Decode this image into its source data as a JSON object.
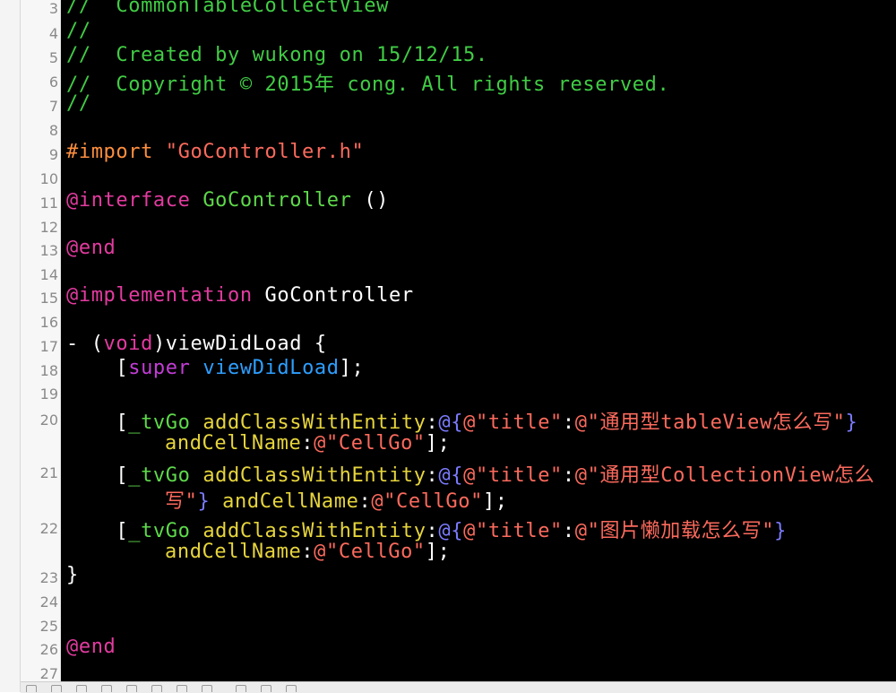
{
  "colors": {
    "background": "#000000",
    "comment": "#41cc45",
    "preprocessor": "#fd8f3f",
    "string": "#fc6a5d",
    "keyword": "#e33ba0",
    "class_name": "#5ed94b",
    "method": "#e6d43c",
    "plain": "#ffffff",
    "self_super": "#c33dd6",
    "system_method": "#2e9fff",
    "literal_brace": "#7b7bff",
    "line_number": "#8a8a8a"
  },
  "editor": {
    "lines": [
      {
        "n": "3",
        "segments": [
          {
            "t": "//  CommonTableCollectView",
            "c": "comment"
          }
        ]
      },
      {
        "n": "4",
        "segments": [
          {
            "t": "//",
            "c": "comment"
          }
        ]
      },
      {
        "n": "5",
        "segments": [
          {
            "t": "//  Created by wukong on 15/12/15.",
            "c": "comment"
          }
        ]
      },
      {
        "n": "6",
        "segments": [
          {
            "t": "//  Copyright © 2015年 cong. All rights reserved.",
            "c": "comment"
          }
        ]
      },
      {
        "n": "7",
        "segments": [
          {
            "t": "//",
            "c": "comment"
          }
        ]
      },
      {
        "n": "8",
        "segments": []
      },
      {
        "n": "9",
        "segments": [
          {
            "t": "#import ",
            "c": "preprocessor"
          },
          {
            "t": "\"GoController.h\"",
            "c": "string"
          }
        ]
      },
      {
        "n": "10",
        "segments": []
      },
      {
        "n": "11",
        "segments": [
          {
            "t": "@interface",
            "c": "keyword"
          },
          {
            "t": " ",
            "c": "plain"
          },
          {
            "t": "GoController",
            "c": "class_name"
          },
          {
            "t": " ()",
            "c": "plain"
          }
        ]
      },
      {
        "n": "12",
        "segments": []
      },
      {
        "n": "13",
        "segments": [
          {
            "t": "@end",
            "c": "keyword"
          }
        ]
      },
      {
        "n": "14",
        "segments": []
      },
      {
        "n": "15",
        "segments": [
          {
            "t": "@implementation",
            "c": "keyword"
          },
          {
            "t": " GoController",
            "c": "plain"
          }
        ]
      },
      {
        "n": "16",
        "segments": []
      },
      {
        "n": "17",
        "segments": [
          {
            "t": "- (",
            "c": "plain"
          },
          {
            "t": "void",
            "c": "keyword"
          },
          {
            "t": ")viewDidLoad {",
            "c": "plain"
          }
        ]
      },
      {
        "n": "18",
        "segments": [
          {
            "t": "    [",
            "c": "plain"
          },
          {
            "t": "super",
            "c": "self_super"
          },
          {
            "t": " ",
            "c": "plain"
          },
          {
            "t": "viewDidLoad",
            "c": "system_method"
          },
          {
            "t": "];",
            "c": "plain"
          }
        ]
      },
      {
        "n": "19",
        "segments": []
      },
      {
        "n": "20",
        "segments": [
          {
            "t": "    [",
            "c": "plain"
          },
          {
            "t": "_tvGo",
            "c": "class_name"
          },
          {
            "t": " ",
            "c": "plain"
          },
          {
            "t": "addClassWithEntity",
            "c": "method"
          },
          {
            "t": ":",
            "c": "plain"
          },
          {
            "t": "@",
            "c": "literal_brace"
          },
          {
            "t": "{",
            "c": "literal_brace"
          },
          {
            "t": "@\"title\"",
            "c": "string"
          },
          {
            "t": ":",
            "c": "plain"
          },
          {
            "t": "@\"通用型tableView怎么写\"",
            "c": "string"
          },
          {
            "t": "}",
            "c": "literal_brace"
          }
        ],
        "cont": [
          {
            "t": "andCellName",
            "c": "method"
          },
          {
            "t": ":",
            "c": "plain"
          },
          {
            "t": "@\"CellGo\"",
            "c": "string"
          },
          {
            "t": "];",
            "c": "plain"
          }
        ]
      },
      {
        "n": "21",
        "segments": [
          {
            "t": "    [",
            "c": "plain"
          },
          {
            "t": "_tvGo",
            "c": "class_name"
          },
          {
            "t": " ",
            "c": "plain"
          },
          {
            "t": "addClassWithEntity",
            "c": "method"
          },
          {
            "t": ":",
            "c": "plain"
          },
          {
            "t": "@",
            "c": "literal_brace"
          },
          {
            "t": "{",
            "c": "literal_brace"
          },
          {
            "t": "@\"title\"",
            "c": "string"
          },
          {
            "t": ":",
            "c": "plain"
          },
          {
            "t": "@\"通用型CollectionView怎么",
            "c": "string"
          }
        ],
        "cont": [
          {
            "t": "写\"",
            "c": "string"
          },
          {
            "t": "}",
            "c": "literal_brace"
          },
          {
            "t": " ",
            "c": "plain"
          },
          {
            "t": "andCellName",
            "c": "method"
          },
          {
            "t": ":",
            "c": "plain"
          },
          {
            "t": "@\"CellGo\"",
            "c": "string"
          },
          {
            "t": "];",
            "c": "plain"
          }
        ]
      },
      {
        "n": "22",
        "segments": [
          {
            "t": "    [",
            "c": "plain"
          },
          {
            "t": "_tvGo",
            "c": "class_name"
          },
          {
            "t": " ",
            "c": "plain"
          },
          {
            "t": "addClassWithEntity",
            "c": "method"
          },
          {
            "t": ":",
            "c": "plain"
          },
          {
            "t": "@",
            "c": "literal_brace"
          },
          {
            "t": "{",
            "c": "literal_brace"
          },
          {
            "t": "@\"title\"",
            "c": "string"
          },
          {
            "t": ":",
            "c": "plain"
          },
          {
            "t": "@\"图片懒加载怎么写\"",
            "c": "string"
          },
          {
            "t": "}",
            "c": "literal_brace"
          }
        ],
        "cont": [
          {
            "t": "andCellName",
            "c": "method"
          },
          {
            "t": ":",
            "c": "plain"
          },
          {
            "t": "@\"CellGo\"",
            "c": "string"
          },
          {
            "t": "];",
            "c": "plain"
          }
        ]
      },
      {
        "n": "23",
        "segments": [
          {
            "t": "}",
            "c": "plain"
          }
        ]
      },
      {
        "n": "24",
        "segments": []
      },
      {
        "n": "25",
        "segments": []
      },
      {
        "n": "26",
        "segments": [
          {
            "t": "@end",
            "c": "keyword"
          }
        ]
      },
      {
        "n": "27",
        "segments": []
      }
    ]
  }
}
